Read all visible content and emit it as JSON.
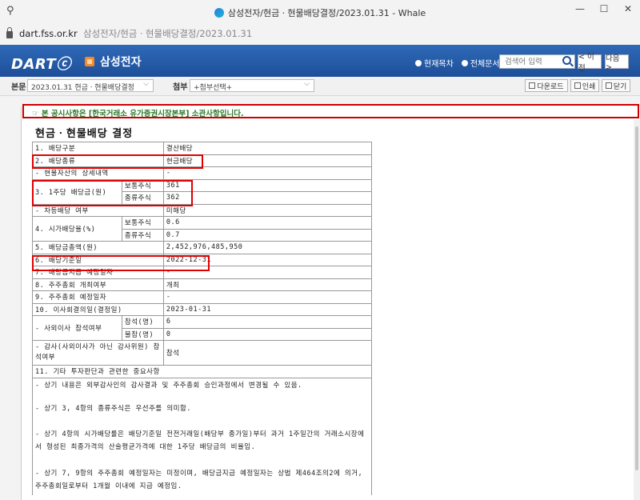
{
  "window": {
    "title": "삼성전자/현금ㆍ현물배당결정/2023.01.31 - Whale",
    "minimize": "—",
    "maximize": "☐",
    "close": "✕"
  },
  "address": {
    "domain": "dart.fss.or.kr",
    "path": "삼성전자/현금ㆍ현물배당결정/2023.01.31"
  },
  "header": {
    "logo": "DARTⓒ",
    "company": "삼성전자",
    "radio_current": "현재목차",
    "radio_all": "전체문서",
    "search_placeholder": "검색어 입력",
    "prev": "< 이전",
    "next": "다음 >"
  },
  "toolbar": {
    "main_label": "본문",
    "main_select": "2023.01.31  현금ㆍ현물배당결정",
    "attach_label": "첨부",
    "attach_select": "+첨부선택+",
    "download": "다운로드",
    "print": "인쇄",
    "close": "닫기"
  },
  "notice": "☞ 본 공시사항은 [한국거래소 유가증권시장본부] 소관사항입니다.",
  "doc_title": "현금ㆍ현물배당 결정",
  "rows": {
    "r1_label": "1. 배당구분",
    "r1_value": "결산배당",
    "r2_label": "2. 배당종류",
    "r2_value": "현금배당",
    "r2a_label": "- 현물자산의 상세내역",
    "r2a_value": "-",
    "r3_label": "3. 1주당 배당금(원)",
    "r3_common_label": "보통주식",
    "r3_common_value": "361",
    "r3_pref_label": "종류주식",
    "r3_pref_value": "362",
    "r3a_label": "- 차등배당 여부",
    "r3a_value": "미해당",
    "r4_label": "4. 시가배당율(%)",
    "r4_common_label": "보통주식",
    "r4_common_value": "0.6",
    "r4_pref_label": "종류주식",
    "r4_pref_value": "0.7",
    "r5_label": "5. 배당금총액(원)",
    "r5_value": "2,452,976,485,950",
    "r6_label": "6. 배당기준일",
    "r6_value": "2022-12-31",
    "r7_label": "7. 배당금지급 예정일자",
    "r7_value": "-",
    "r8_label": "8. 주주총회 개최여부",
    "r8_value": "개최",
    "r9_label": "9. 주주총회 예정일자",
    "r9_value": "-",
    "r10_label": "10. 이사회결의일(결정일)",
    "r10_value": "2023-01-31",
    "r10a_label": "- 사외이사 참석여부",
    "r10a_attend_label": "참석(명)",
    "r10a_attend_value": "6",
    "r10a_absent_label": "불참(명)",
    "r10a_absent_value": "0",
    "r10b_label": "- 감사(사외이사가 아닌 감사위원) 참석여부",
    "r10b_value": "참석",
    "r11_label": "11. 기타 투자판단과 관련한 중요사항",
    "note1": "- 상기 내용은 외부감사인의 감사결과 및 주주총회 승인과정에서 변경될 수 있음.",
    "note2": "- 상기 3, 4항의 종류주식은 우선주를 의미함.",
    "note3": "- 상기 4항의 시가배당률은 배당기준일 전전거래일(배당부 종가일)부터 과거 1주일간의 거래소시장에서 형성된 최종가격의 산술평균가격에 대한 1주당 배당금의 비율임.",
    "note4": "- 상기 7, 9항의 주주총회 예정일자는 미정이며, 배당금지급 예정일자는 상법 제464조의2에 의거, 주주총회일로부터 1개월 이내에 지급 예정임."
  }
}
